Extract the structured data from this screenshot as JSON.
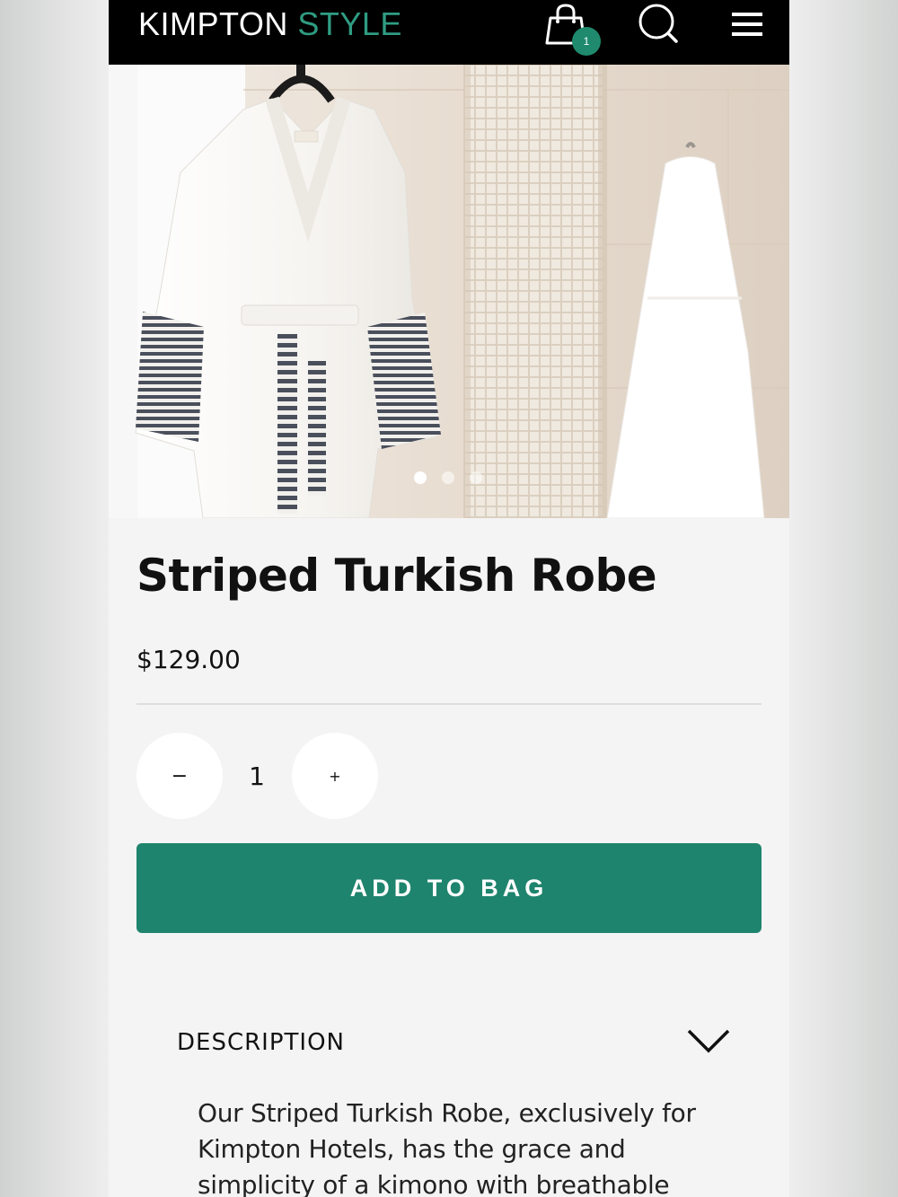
{
  "header": {
    "logo_primary": "KIMPTON",
    "logo_accent": "STYLE",
    "cart_count": "1",
    "colors": {
      "background": "#000000",
      "accent": "#2f9c82"
    }
  },
  "gallery": {
    "image_icon": "product-photo",
    "slide_count": 3,
    "active_slide": 1
  },
  "product": {
    "title": "Striped Turkish Robe",
    "price": "$129.00"
  },
  "quantity": {
    "decrement_label": "−",
    "value": "1",
    "increment_label": "+"
  },
  "actions": {
    "add_to_bag_label": "ADD TO BAG",
    "button_color": "#1f846d"
  },
  "description": {
    "heading": "DESCRIPTION",
    "text": "Our Striped Turkish Robe, exclusively for Kimpton Hotels, has the grace and simplicity of a kimono with breathable"
  }
}
